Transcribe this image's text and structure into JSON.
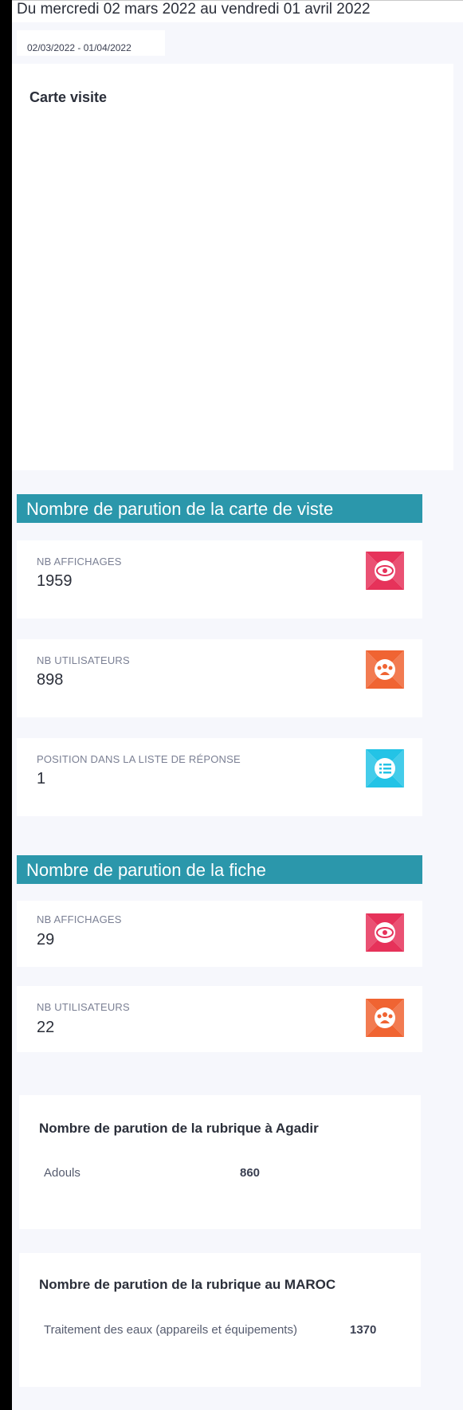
{
  "header": {
    "range_title": "Du mercredi 02 mars 2022 au vendredi 01 avril 2022",
    "date_input_value": "02/03/2022 - 01/04/2022"
  },
  "map_card": {
    "title": "Carte visite"
  },
  "section_carte": {
    "title": "Nombre de parution de la carte de viste",
    "stats": [
      {
        "label": "NB AFFICHAGES",
        "value": "1959",
        "icon": "eye-icon",
        "color": "#e6325a"
      },
      {
        "label": "NB UTILISATEURS",
        "value": "898",
        "icon": "users-icon",
        "color": "#f06432"
      },
      {
        "label": "POSITION DANS LA LISTE DE RÉPONSE",
        "value": "1",
        "icon": "list-icon",
        "color": "#23c3e6"
      }
    ]
  },
  "section_fiche": {
    "title": "Nombre de parution de la fiche",
    "stats": [
      {
        "label": "NB AFFICHAGES",
        "value": "29",
        "icon": "eye-icon",
        "color": "#e6325a"
      },
      {
        "label": "NB UTILISATEURS",
        "value": "22",
        "icon": "users-icon",
        "color": "#f06432"
      }
    ]
  },
  "rubrique_agadir": {
    "title": "Nombre de parution de la rubrique à Agadir",
    "rows": [
      {
        "name": "Adouls",
        "count": "860"
      }
    ]
  },
  "rubrique_maroc": {
    "title": "Nombre de parution de la rubrique au MAROC",
    "rows": [
      {
        "name": "Traitement des eaux (appareils et équipements)",
        "count": "1370"
      }
    ]
  }
}
